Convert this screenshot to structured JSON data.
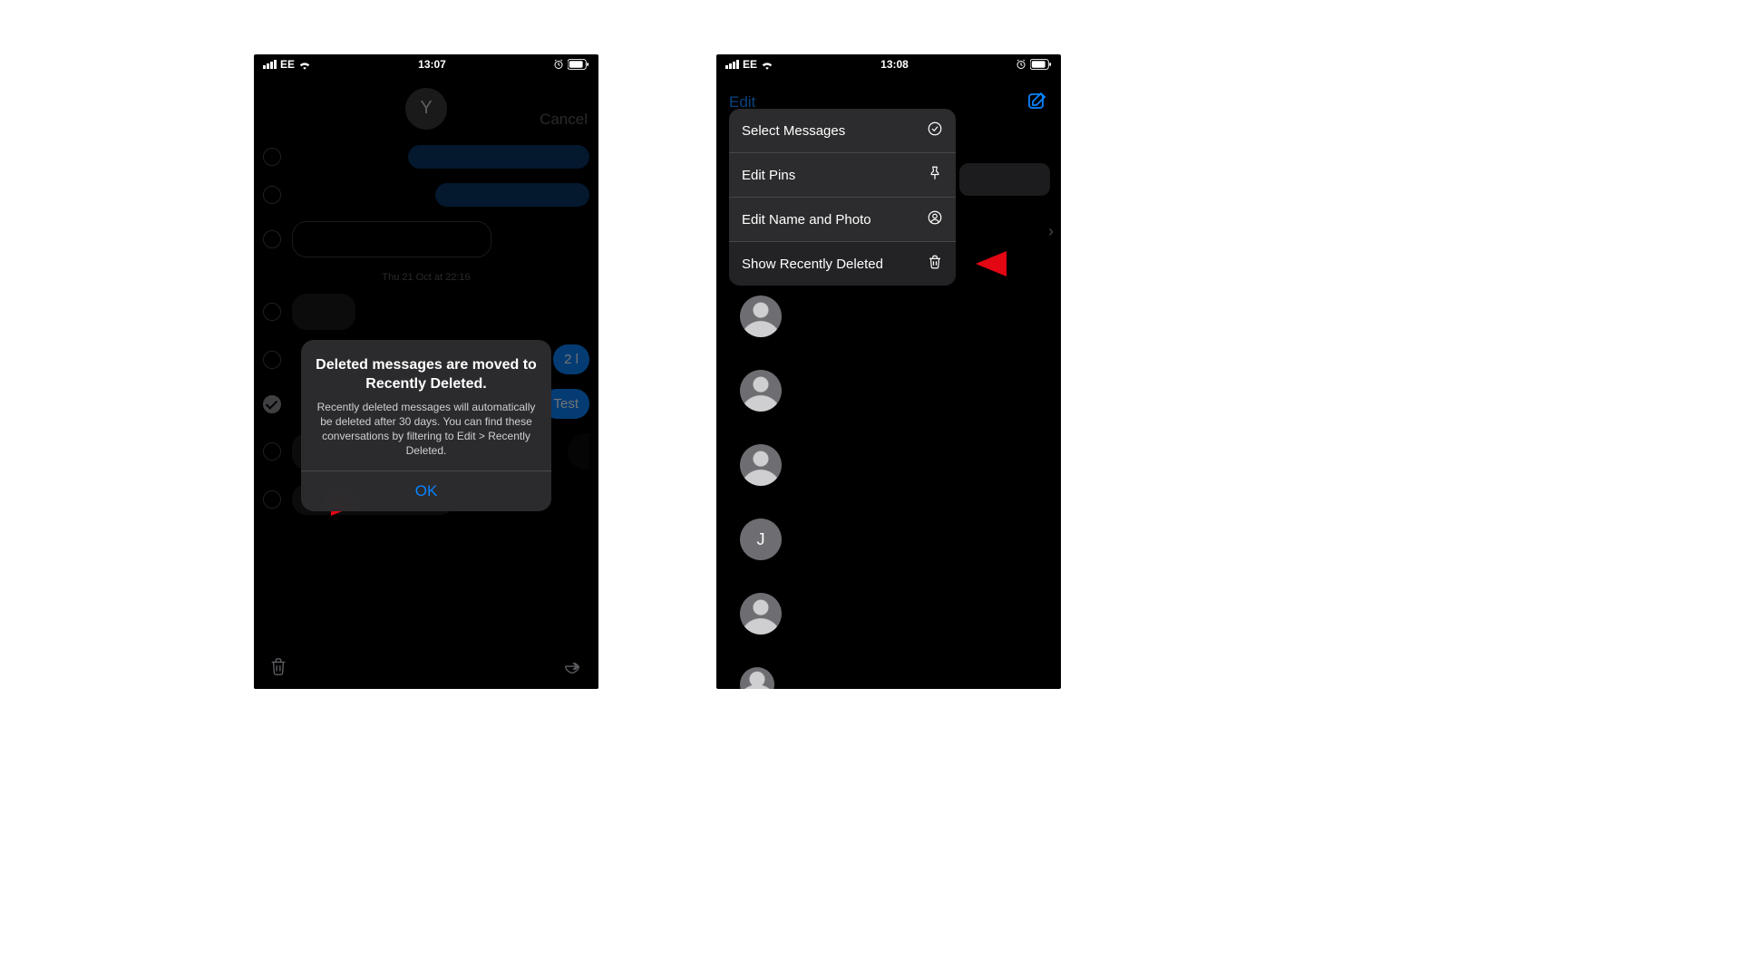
{
  "left": {
    "status": {
      "carrier": "EE",
      "time": "13:07"
    },
    "header": {
      "avatar_letter": "Y",
      "cancel_label": "Cancel"
    },
    "date_separator": "Thu 21 Oct at 22:16",
    "bubbles": {
      "partial_right": "2 l",
      "test": "Test"
    },
    "alert": {
      "title": "Deleted messages are moved to Recently Deleted.",
      "message": "Recently deleted messages will automatically be deleted after 30 days. You can find these conversations by filtering to Edit > Recently Deleted.",
      "ok_label": "OK"
    },
    "toolbar_icons": {
      "trash": "trash-icon",
      "share": "share-icon"
    }
  },
  "right": {
    "status": {
      "carrier": "EE",
      "time": "13:08"
    },
    "nav": {
      "edit_label": "Edit"
    },
    "menu": {
      "items": [
        {
          "label": "Select Messages",
          "icon": "select-icon"
        },
        {
          "label": "Edit Pins",
          "icon": "pin-icon"
        },
        {
          "label": "Edit Name and Photo",
          "icon": "person-circle-icon"
        },
        {
          "label": "Show Recently Deleted",
          "icon": "trash-icon"
        }
      ]
    },
    "chat_list": {
      "avatars": [
        {
          "type": "person"
        },
        {
          "type": "person"
        },
        {
          "type": "person"
        },
        {
          "type": "letter",
          "letter": "J"
        },
        {
          "type": "person"
        },
        {
          "type": "person",
          "small": true
        }
      ]
    }
  },
  "colors": {
    "accent": "#0a84ff",
    "annotation_red": "#e30613"
  }
}
